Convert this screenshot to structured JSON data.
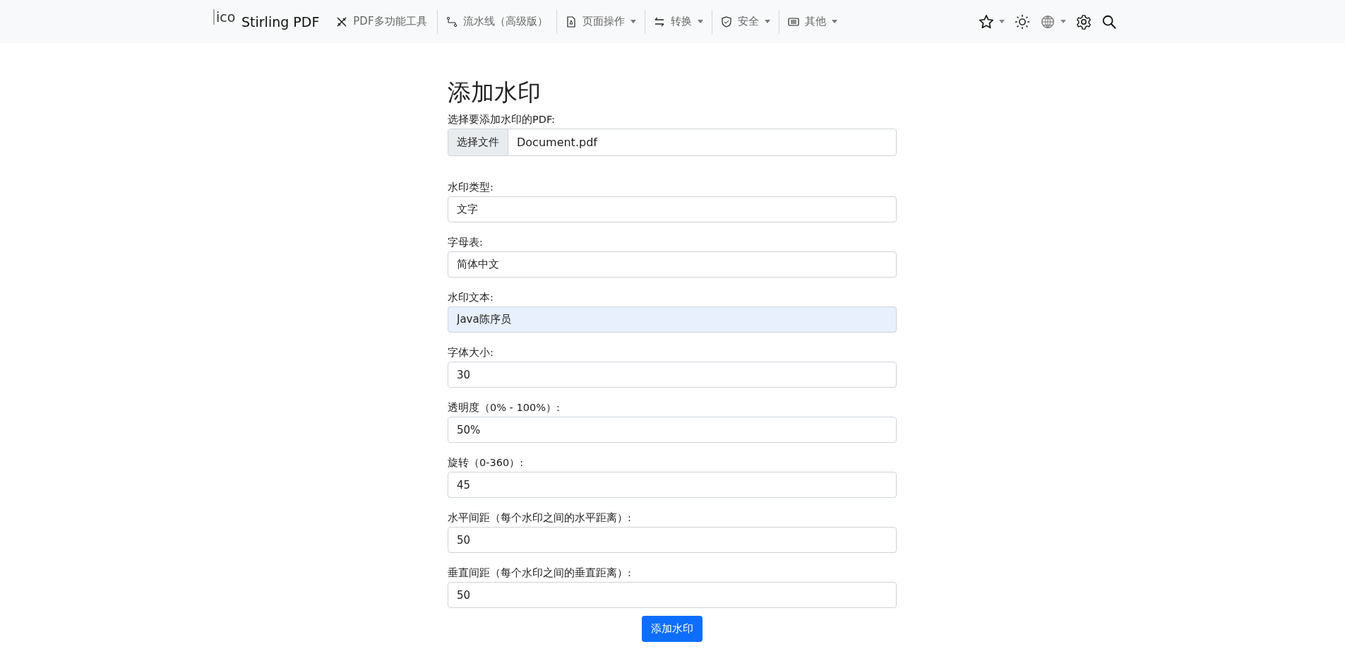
{
  "navbar": {
    "logo_alt": "ico",
    "brand": "Stirling PDF",
    "items": [
      {
        "label": "PDF多功能工具",
        "dropdown": false
      },
      {
        "label": "流水线（高级版）",
        "dropdown": false
      },
      {
        "label": "页面操作",
        "dropdown": true
      },
      {
        "label": "转换",
        "dropdown": true
      },
      {
        "label": "安全",
        "dropdown": true
      },
      {
        "label": "其他",
        "dropdown": true
      }
    ],
    "right": [
      {
        "dropdown": true
      },
      {
        "dropdown": false
      },
      {
        "dropdown": true
      },
      {
        "dropdown": false
      },
      {
        "dropdown": false
      }
    ]
  },
  "form": {
    "title": "添加水印",
    "file": {
      "label": "选择要添加水印的PDF:",
      "button": "选择文件",
      "value": "Document.pdf"
    },
    "fields": [
      {
        "label": "水印类型:",
        "value": "文字",
        "highlighted": false
      },
      {
        "label": "字母表:",
        "value": "简体中文",
        "highlighted": false
      },
      {
        "label": "水印文本:",
        "value": "Java陈序员",
        "highlighted": true
      },
      {
        "label": "字体大小:",
        "value": "30",
        "highlighted": false
      },
      {
        "label": "透明度（0% - 100%）:",
        "value": "50%",
        "highlighted": false
      },
      {
        "label": "旋转（0-360）:",
        "value": "45",
        "highlighted": false
      },
      {
        "label": "水平间距（每个水印之间的水平距离）:",
        "value": "50",
        "highlighted": false
      },
      {
        "label": "垂直间距（每个水印之间的垂直距离）:",
        "value": "50",
        "highlighted": false
      }
    ],
    "submit": "添加水印"
  }
}
